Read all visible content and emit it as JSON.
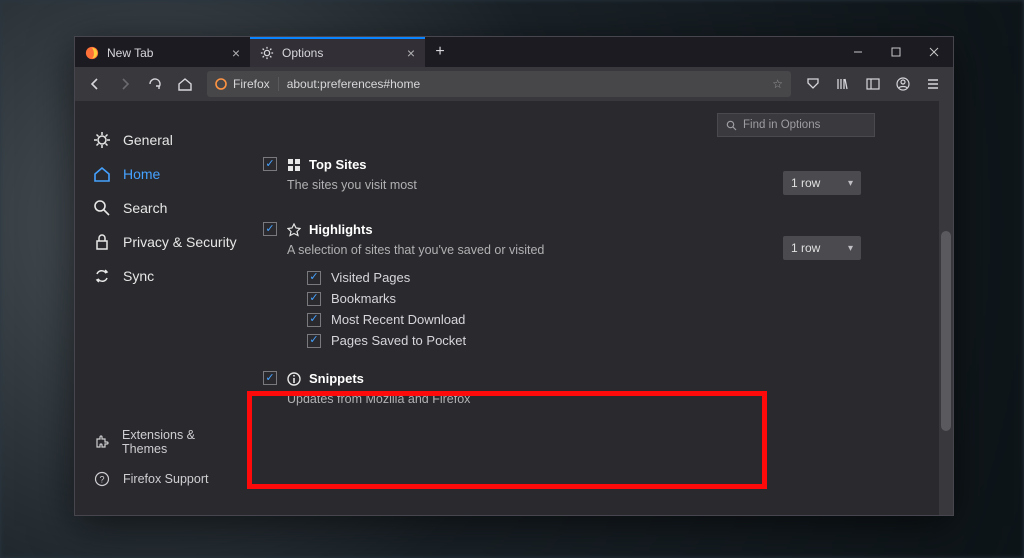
{
  "tabs": [
    {
      "label": "New Tab",
      "active": false
    },
    {
      "label": "Options",
      "active": true
    }
  ],
  "urlbar": {
    "identity_label": "Firefox",
    "url": "about:preferences#home"
  },
  "search": {
    "placeholder": "Find in Options"
  },
  "sidebar": {
    "items": [
      {
        "label": "General"
      },
      {
        "label": "Home"
      },
      {
        "label": "Search"
      },
      {
        "label": "Privacy & Security"
      },
      {
        "label": "Sync"
      }
    ],
    "footer": [
      {
        "label": "Extensions & Themes"
      },
      {
        "label": "Firefox Support"
      }
    ]
  },
  "sections": {
    "top_sites": {
      "title": "Top Sites",
      "desc": "The sites you visit most",
      "rows": "1 row"
    },
    "highlights": {
      "title": "Highlights",
      "desc": "A selection of sites that you've saved or visited",
      "rows": "1 row",
      "items": [
        "Visited Pages",
        "Bookmarks",
        "Most Recent Download",
        "Pages Saved to Pocket"
      ]
    },
    "snippets": {
      "title": "Snippets",
      "desc": "Updates from Mozilla and Firefox"
    }
  }
}
